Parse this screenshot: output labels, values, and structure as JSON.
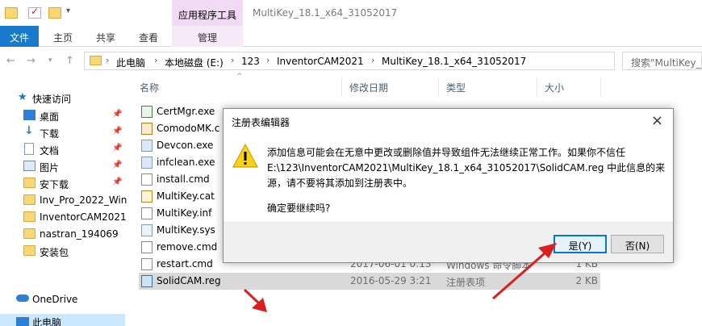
{
  "window": {
    "title": "MultiKey_18.1_x64_31052017",
    "context_tab_group": "应用程序工具"
  },
  "ribbon": {
    "tabs": [
      "文件",
      "主页",
      "共享",
      "查看",
      "管理"
    ]
  },
  "address": {
    "crumbs": [
      "此电脑",
      "本地磁盘 (E:)",
      "123",
      "InventorCAM2021",
      "MultiKey_18.1_x64_31052017"
    ],
    "search_placeholder": "搜索\"MultiKey_1"
  },
  "sidebar": {
    "quick_access": "快速访问",
    "items": [
      {
        "label": "桌面",
        "icon": "desktop-icon",
        "pinned": true
      },
      {
        "label": "下载",
        "icon": "download-icon",
        "pinned": true
      },
      {
        "label": "文档",
        "icon": "documents-icon",
        "pinned": true
      },
      {
        "label": "图片",
        "icon": "pictures-icon",
        "pinned": true
      },
      {
        "label": "安下载",
        "icon": "folder-icon",
        "pinned": true
      },
      {
        "label": "Inv_Pro_2022_Win",
        "icon": "folder-icon",
        "pinned": false
      },
      {
        "label": "InventorCAM2021",
        "icon": "folder-icon",
        "pinned": false
      },
      {
        "label": "nastran_194069",
        "icon": "folder-icon",
        "pinned": false
      },
      {
        "label": "安装包",
        "icon": "folder-icon",
        "pinned": false
      }
    ],
    "onedrive": "OneDrive",
    "this_pc": "此电脑"
  },
  "columns": {
    "name": "名称",
    "date": "修改日期",
    "type": "类型",
    "size": "大小"
  },
  "files": [
    {
      "name": "CertMgr.exe",
      "date": "",
      "type": "",
      "size": ""
    },
    {
      "name": "ComodoMK.c",
      "date": "",
      "type": "",
      "size": ""
    },
    {
      "name": "Devcon.exe",
      "date": "",
      "type": "",
      "size": ""
    },
    {
      "name": "infclean.exe",
      "date": "",
      "type": "",
      "size": ""
    },
    {
      "name": "install.cmd",
      "date": "",
      "type": "",
      "size": ""
    },
    {
      "name": "MultiKey.cat",
      "date": "",
      "type": "",
      "size": ""
    },
    {
      "name": "MultiKey.inf",
      "date": "",
      "type": "",
      "size": ""
    },
    {
      "name": "MultiKey.sys",
      "date": "",
      "type": "",
      "size": ""
    },
    {
      "name": "remove.cmd",
      "date": "",
      "type": "",
      "size": ""
    },
    {
      "name": "restart.cmd",
      "date": "2017-06-01 0:13",
      "type": "Windows 命令脚本",
      "size": "1 KB"
    },
    {
      "name": "SolidCAM.reg",
      "date": "2016-05-29 3:21",
      "type": "注册表项",
      "size": "2 KB"
    }
  ],
  "dialog": {
    "title": "注册表编辑器",
    "message_lines": [
      "添加信息可能会在无意中更改或删除值并导致组件无法继续正常工作。如果你不信任",
      "E:\\123\\InventorCAM2021\\MultiKey_18.1_x64_31052017\\SolidCAM.reg 中此信息的来",
      "源，请不要将其添加到注册表中。"
    ],
    "confirm": "确定要继续吗?",
    "yes_label": "是(Y)",
    "no_label": "否(N)"
  },
  "colors": {
    "accent": "#1979ca",
    "context_tab": "#f1daf3",
    "annotation_arrow": "#d9201e",
    "selected_row": "#d9d9d9"
  }
}
